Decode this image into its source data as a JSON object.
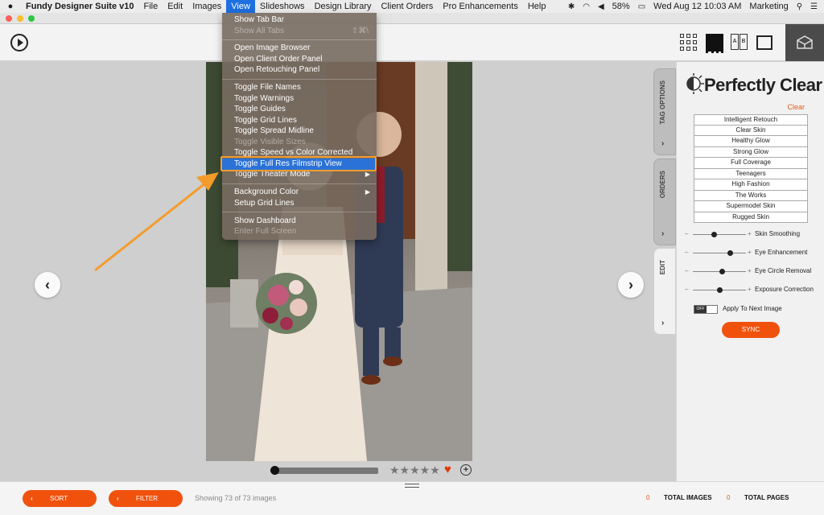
{
  "menubar": {
    "app_name": "Fundy Designer Suite v10",
    "menus": [
      "File",
      "Edit",
      "Images",
      "View",
      "Slideshows",
      "Design Library",
      "Client Orders",
      "Pro Enhancements",
      "Help"
    ],
    "active_menu": "View",
    "battery": "58%",
    "datetime": "Wed Aug 12  10:03 AM",
    "user": "Marketing"
  },
  "view_menu": {
    "items": [
      {
        "label": "Show Tab Bar",
        "enabled": true
      },
      {
        "label": "Show All Tabs",
        "enabled": false,
        "shortcut": "⇧⌘\\"
      },
      {
        "label": "Open Image Browser",
        "enabled": true
      },
      {
        "label": "Open Client Order Panel",
        "enabled": true
      },
      {
        "label": "Open Retouching Panel",
        "enabled": true
      },
      {
        "label": "Toggle File Names",
        "enabled": true
      },
      {
        "label": "Toggle Warnings",
        "enabled": true
      },
      {
        "label": "Toggle Guides",
        "enabled": true
      },
      {
        "label": "Toggle Grid Lines",
        "enabled": true
      },
      {
        "label": "Toggle Spread Midline",
        "enabled": true
      },
      {
        "label": "Toggle Visible Sizes",
        "enabled": false
      },
      {
        "label": "Toggle Speed vs Color Corrected",
        "enabled": true
      },
      {
        "label": "Toggle Full Res Filmstrip View",
        "enabled": true,
        "selected": true
      },
      {
        "label": "Toggle Theater Mode",
        "enabled": true,
        "submenu": true
      },
      {
        "label": "Background Color",
        "enabled": true,
        "submenu": true
      },
      {
        "label": "Setup Grid Lines",
        "enabled": true
      },
      {
        "label": "Show Dashboard",
        "enabled": true
      },
      {
        "label": "Enter Full Screen",
        "enabled": false
      }
    ]
  },
  "side_tabs": [
    "TAG OPTIONS",
    "ORDERS",
    "EDIT"
  ],
  "panel": {
    "title": "Perfectly Clear",
    "clear_label": "Clear",
    "presets": [
      "Intelligent Retouch",
      "Clear Skin",
      "Healthy Glow",
      "Strong Glow",
      "Full Coverage",
      "Teenagers",
      "High Fashion",
      "The Works",
      "Supermodel Skin",
      "Rugged Skin"
    ],
    "sliders": [
      {
        "label": "Skin Smoothing",
        "value": 0.4
      },
      {
        "label": "Eye Enhancement",
        "value": 0.7
      },
      {
        "label": "Eye Circle Removal",
        "value": 0.55
      },
      {
        "label": "Exposure Correction",
        "value": 0.5
      }
    ],
    "toggle_state": "OFF",
    "apply_label": "Apply To Next Image",
    "sync_label": "SYNC"
  },
  "photo_controls": {
    "stars": "★★★★★",
    "heart": "♥",
    "add": "+"
  },
  "bottom": {
    "sort_label": "SORT",
    "filter_label": "FILTER",
    "showing": "Showing 73 of 73 images",
    "total_images_count": "0",
    "total_images_label": "TOTAL IMAGES",
    "total_pages_count": "0",
    "total_pages_label": "TOTAL PAGES"
  },
  "colors": {
    "accent": "#f0520e",
    "menu_highlight": "#2a72d8",
    "annotation": "#f39c2b"
  }
}
